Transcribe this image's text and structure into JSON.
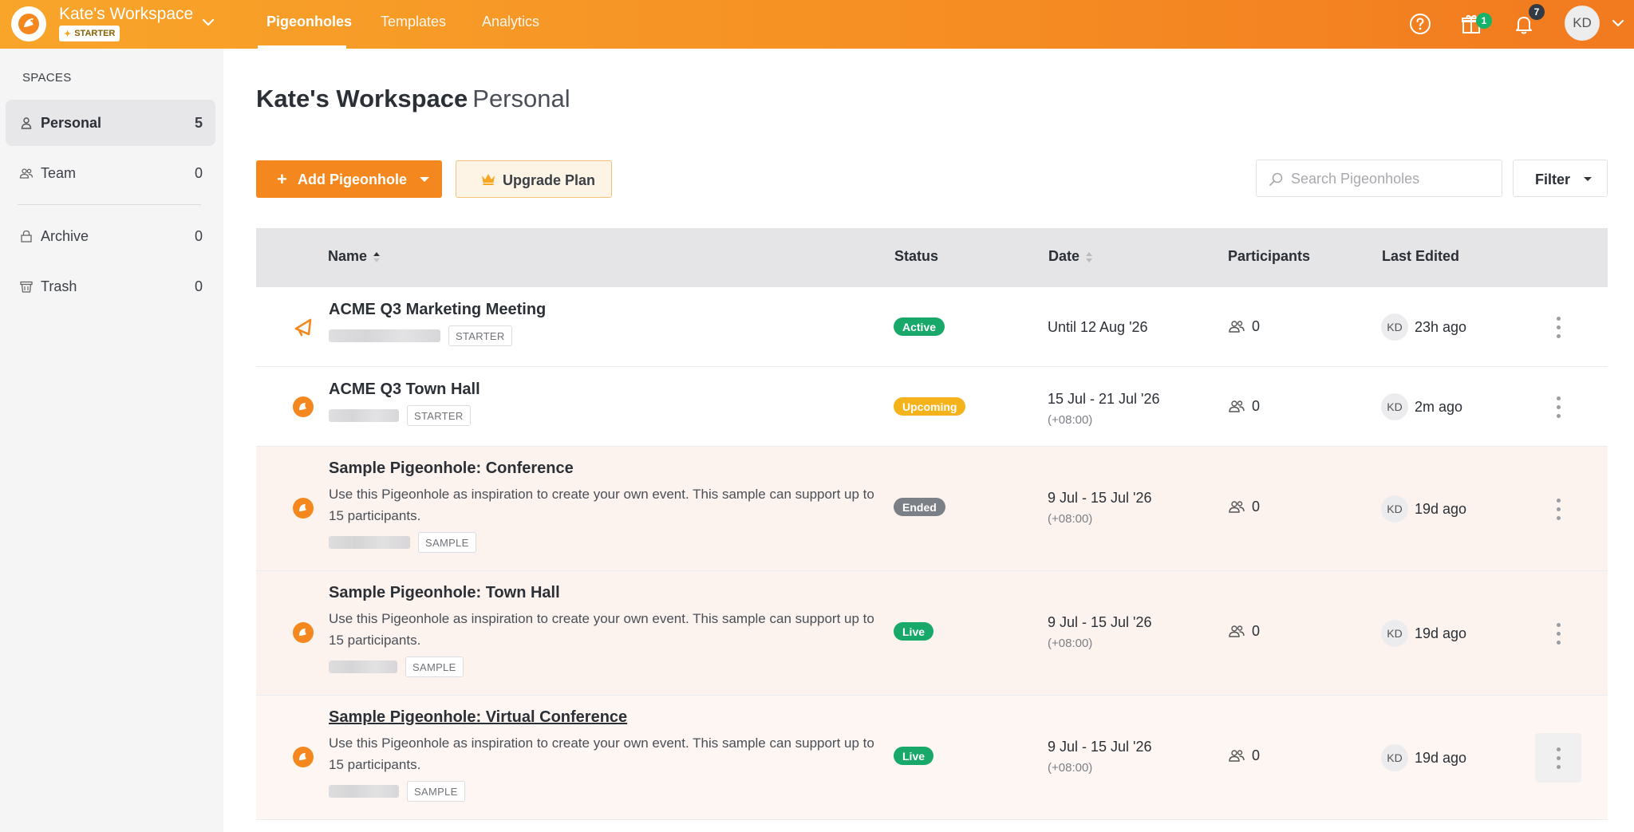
{
  "workspace": {
    "name": "Kate's Workspace",
    "plan_badge": "STARTER"
  },
  "nav": {
    "tabs": [
      {
        "label": "Pigeonholes",
        "active": true
      },
      {
        "label": "Templates",
        "active": false
      },
      {
        "label": "Analytics",
        "active": false
      }
    ]
  },
  "top_icons": {
    "help": "help-circle-icon",
    "gift": "gift-icon",
    "gift_badge": "1",
    "bell": "bell-icon",
    "bell_badge": "7",
    "avatar_initials": "KD"
  },
  "sidebar": {
    "section_label": "SPACES",
    "items": [
      {
        "label": "Personal",
        "count": "5",
        "icon": "person-icon",
        "active": true
      },
      {
        "label": "Team",
        "count": "0",
        "icon": "team-icon",
        "active": false
      },
      {
        "label": "Archive",
        "count": "0",
        "icon": "archive-icon",
        "active": false
      },
      {
        "label": "Trash",
        "count": "0",
        "icon": "trash-icon",
        "active": false
      }
    ]
  },
  "page": {
    "title_main": "Kate's Workspace",
    "title_sub": "Personal"
  },
  "toolbar": {
    "add_label": "Add Pigeonhole",
    "upgrade_label": "Upgrade Plan",
    "search_placeholder": "Search Pigeonholes",
    "filter_label": "Filter"
  },
  "table": {
    "headers": {
      "name": "Name",
      "status": "Status",
      "date": "Date",
      "participants": "Participants",
      "last_edited": "Last Edited"
    },
    "rows": [
      {
        "title": "ACME Q3 Marketing Meeting",
        "description": "",
        "tag": "STARTER",
        "status": "Active",
        "status_kind": "active",
        "date": "Until 12 Aug '26",
        "tz": "",
        "participants": "0",
        "editor": "KD",
        "edited": "23h ago",
        "icon": "megaphone-icon"
      },
      {
        "title": "ACME Q3 Town Hall",
        "description": "",
        "tag": "STARTER",
        "status": "Upcoming",
        "status_kind": "upcoming",
        "date": "15 Jul - 21 Jul '26",
        "tz": "(+08:00)",
        "participants": "0",
        "editor": "KD",
        "edited": "2m ago",
        "icon": "pigeonhole-icon"
      },
      {
        "title": "Sample Pigeonhole: Conference",
        "description": "Use this Pigeonhole as inspiration to create your own event. This sample can support up to 15 participants.",
        "tag": "SAMPLE",
        "status": "Ended",
        "status_kind": "ended",
        "date": "9 Jul - 15 Jul '26",
        "tz": "(+08:00)",
        "participants": "0",
        "editor": "KD",
        "edited": "19d ago",
        "icon": "pigeonhole-icon"
      },
      {
        "title": "Sample Pigeonhole: Town Hall",
        "description": "Use this Pigeonhole as inspiration to create your own event. This sample can support up to 15 participants.",
        "tag": "SAMPLE",
        "status": "Live",
        "status_kind": "live",
        "date": "9 Jul - 15 Jul '26",
        "tz": "(+08:00)",
        "participants": "0",
        "editor": "KD",
        "edited": "19d ago",
        "icon": "pigeonhole-icon"
      },
      {
        "title": "Sample Pigeonhole: Virtual Conference",
        "description": "Use this Pigeonhole as inspiration to create your own event. This sample can support up to 15 participants.",
        "tag": "SAMPLE",
        "status": "Live",
        "status_kind": "live",
        "date": "9 Jul - 15 Jul '26",
        "tz": "(+08:00)",
        "participants": "0",
        "editor": "KD",
        "edited": "19d ago",
        "icon": "pigeonhole-icon"
      }
    ]
  },
  "colors": {
    "brand_orange": "#f4881f",
    "live_green": "#17a86a",
    "upcoming_yellow": "#f4b21b",
    "ended_gray": "#7b7f86"
  }
}
